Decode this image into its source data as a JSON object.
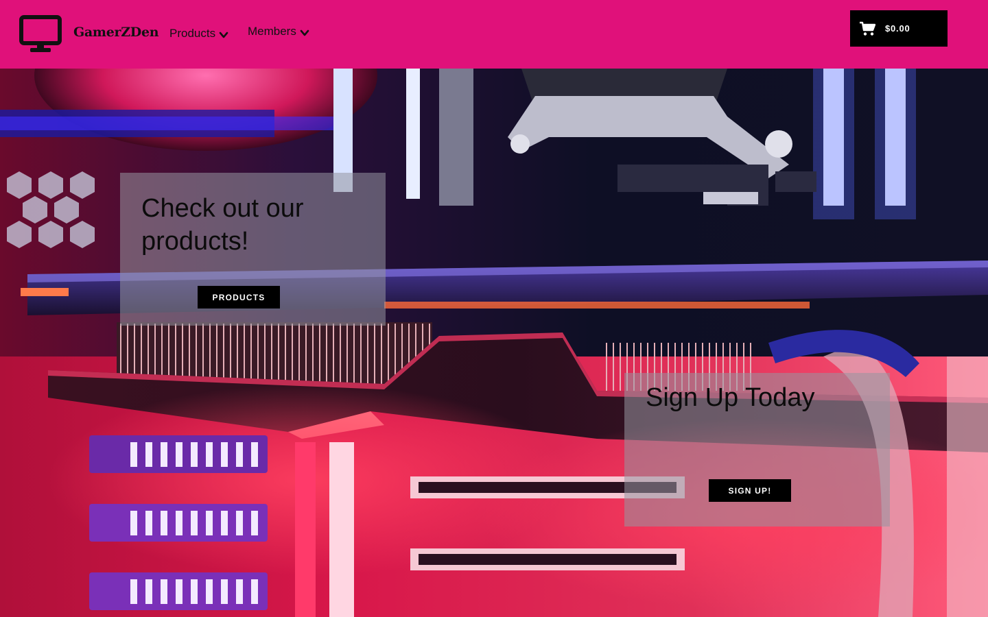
{
  "header": {
    "brand": "GamerZDen",
    "logo_icon": "monitor-icon",
    "background_color": "#e0117a",
    "nav": [
      {
        "label": "Products",
        "icon": "chevron-down-icon"
      },
      {
        "label": "Members",
        "icon": "chevron-down-icon"
      }
    ],
    "cart": {
      "icon": "cart-icon",
      "total": "$0.00"
    }
  },
  "hero": {
    "background": "gaming PC interior with neon pink, red and blue lighting",
    "cards": {
      "products": {
        "heading": "Check out our products!",
        "button_label": "PRODUCTS"
      },
      "signup": {
        "heading": "Sign Up Today",
        "button_label": "SIGN UP!"
      }
    }
  }
}
